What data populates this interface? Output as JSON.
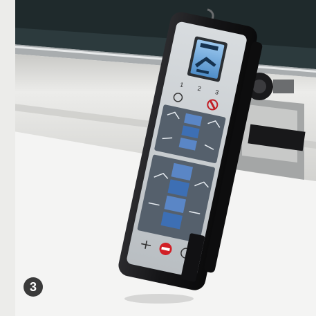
{
  "photo": {
    "badge_number": "3",
    "colors": {
      "background": "#f4f4f3",
      "dark_panel": "#1f2a2c",
      "rail": "#d9d9d6",
      "remote_body": "#1b1b1d",
      "faceplate": "#cfd3d6",
      "keypad": "#55606c",
      "key_blue": "#5a86c6",
      "lcd": "#6fa6d8",
      "stop_red": "#d11f26",
      "badge": "#3a3a3a"
    }
  },
  "remote": {
    "preset_numbers": [
      "1",
      "2",
      "3"
    ]
  }
}
